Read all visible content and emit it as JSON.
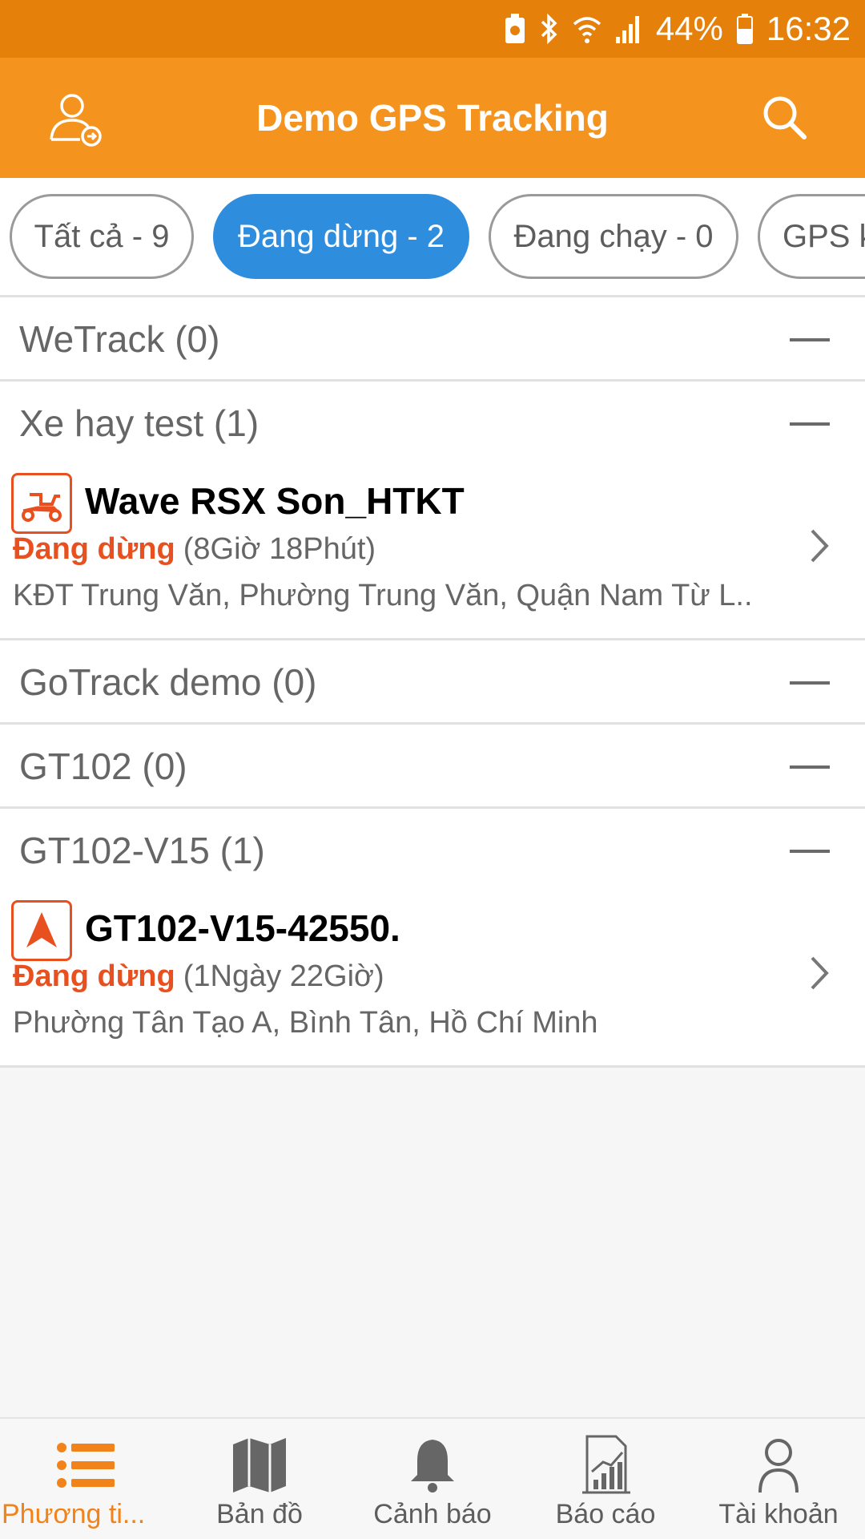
{
  "status_bar": {
    "battery_percent": "44%",
    "time": "16:32"
  },
  "app_bar": {
    "title": "Demo GPS Tracking",
    "left_icon": "user-switch-icon",
    "right_icon": "search-icon"
  },
  "filters": [
    {
      "label": "Tất cả - 9",
      "active": false
    },
    {
      "label": "Đang dừng - 2",
      "active": true
    },
    {
      "label": "Đang chạy - 0",
      "active": false
    },
    {
      "label": "GPS k",
      "active": false
    }
  ],
  "groups": [
    {
      "label": "WeTrack (0)"
    },
    {
      "label": "Xe hay test (1)"
    },
    {
      "label": "GoTrack demo (0)"
    },
    {
      "label": "GT102 (0)"
    },
    {
      "label": "GT102-V15 (1)"
    }
  ],
  "vehicles": [
    {
      "icon": "scooter-icon",
      "name": "Wave RSX Son_HTKT",
      "state": "Đang dừng",
      "duration": "(8Giờ 18Phút)",
      "address": "KĐT Trung Văn, Phường Trung Văn, Quận Nam Từ L.."
    },
    {
      "icon": "navigation-arrow-icon",
      "name": "GT102-V15-42550.",
      "state": "Đang dừng",
      "duration": "(1Ngày 22Giờ)",
      "address": "Phường Tân Tạo A, Bình Tân, Hồ Chí Minh"
    }
  ],
  "bottom_nav": [
    {
      "label": "Phương ti...",
      "icon": "list-icon",
      "active": true
    },
    {
      "label": "Bản đồ",
      "icon": "map-icon",
      "active": false
    },
    {
      "label": "Cảnh báo",
      "icon": "bell-icon",
      "active": false
    },
    {
      "label": "Báo cáo",
      "icon": "report-icon",
      "active": false
    },
    {
      "label": "Tài khoản",
      "icon": "account-icon",
      "active": false
    }
  ],
  "colors": {
    "status_bar": "#e5800b",
    "app_bar": "#f5931f",
    "active_chip": "#2f8dde",
    "stopped_state": "#e8501f",
    "active_nav": "#f2831a"
  }
}
